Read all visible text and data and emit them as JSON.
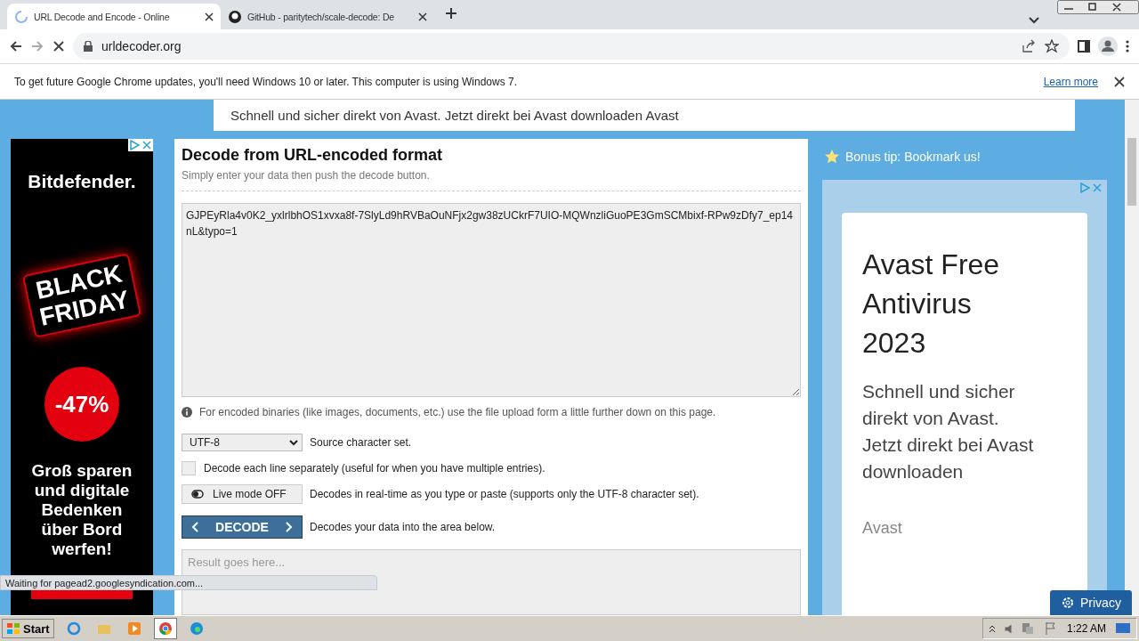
{
  "browser": {
    "tabs": [
      {
        "title": "URL Decode and Encode - Online",
        "selected": true,
        "loading": true
      },
      {
        "title": "GitHub - paritytech/scale-decode: De",
        "selected": false,
        "loading": false
      }
    ],
    "address": "urldecoder.org",
    "infobar": {
      "message": "To get future Google Chrome updates, you'll need Windows 10 or later. This computer is using Windows 7.",
      "link": "Learn more"
    }
  },
  "top_ad": {
    "text": "Schnell und sicher direkt von Avast. Jetzt direkt bei Avast downloaden Avast"
  },
  "left_ad": {
    "brand": "Bitdefender.",
    "headline": [
      "BLACK",
      "FRIDAY"
    ],
    "discount": "-47%",
    "slogan": [
      "Groß sparen",
      "und digitale",
      "Bedenken",
      "über Bord",
      "werfen!"
    ]
  },
  "main": {
    "title": "Decode from URL-encoded format",
    "subtitle": "Simply enter your data then push the decode button.",
    "input_value": "GJPEyRla4v0K2_yxlrlbhOS1xvxa8f-7SlyLd9hRVBaOuNFjx2gw38zUCkrF7UIO-MQWnzliGuoPE3GmSCMbixf-RPw9zDfy7_ep14nL&typo=1",
    "info": "For encoded binaries (like images, documents, etc.) use the file upload form a little further down on this page.",
    "charset": {
      "value": "UTF-8",
      "label": "Source character set."
    },
    "decode_lines": {
      "checked": false,
      "label": "Decode each line separately (useful for when you have multiple entries)."
    },
    "live_mode": {
      "on": false,
      "label": "Live mode OFF",
      "description": "Decodes in real-time as you type or paste (supports only the UTF-8 character set)."
    },
    "decode_button": {
      "label": "DECODE",
      "description": "Decodes your data into the area below."
    },
    "result": {
      "placeholder": "Result goes here..."
    }
  },
  "sidebar": {
    "bonus_tip": "Bonus tip: Bookmark us!",
    "ad": {
      "title": [
        "Avast Free",
        "Antivirus",
        "2023"
      ],
      "body": [
        "Schnell und sicher",
        "direkt von Avast.",
        "Jetzt direkt bei Avast",
        "downloaden"
      ],
      "advertiser": "Avast"
    }
  },
  "privacy_button": "Privacy",
  "status": "Waiting for pagead2.googlesyndication.com...",
  "taskbar": {
    "start": "Start",
    "time": "1:22 AM"
  }
}
